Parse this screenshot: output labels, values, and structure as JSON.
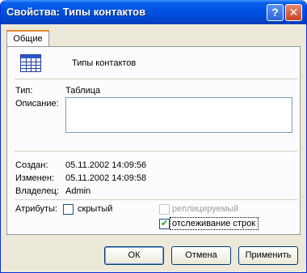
{
  "window": {
    "title": "Свойства: Типы контактов"
  },
  "title_buttons": {
    "help": "?",
    "close": "✕"
  },
  "tabs": [
    {
      "label": "Общие"
    }
  ],
  "object": {
    "icon": "table-icon",
    "name": "Типы контактов"
  },
  "fields": {
    "type_label": "Тип:",
    "type_value": "Таблица",
    "description_label": "Описание:",
    "description_value": "",
    "created_label": "Создан:",
    "created_value": "05.11.2002 14:09:56",
    "modified_label": "Изменен:",
    "modified_value": "05.11.2002 14:09:58",
    "owner_label": "Владелец:",
    "owner_value": "Admin"
  },
  "attributes": {
    "label": "Атрибуты:",
    "hidden": {
      "label": "скрытый",
      "checked": false
    },
    "replicated": {
      "label": "реплицируемый",
      "checked": false,
      "disabled": true
    },
    "row_tracking": {
      "label": "отслеживание строк",
      "checked": true
    }
  },
  "buttons": {
    "ok": "ОК",
    "cancel": "Отмена",
    "apply": "Применить"
  },
  "colors": {
    "title_bar": "#0055e5",
    "dialog_bg": "#ece9d8",
    "tab_accent": "#e68b2c"
  }
}
